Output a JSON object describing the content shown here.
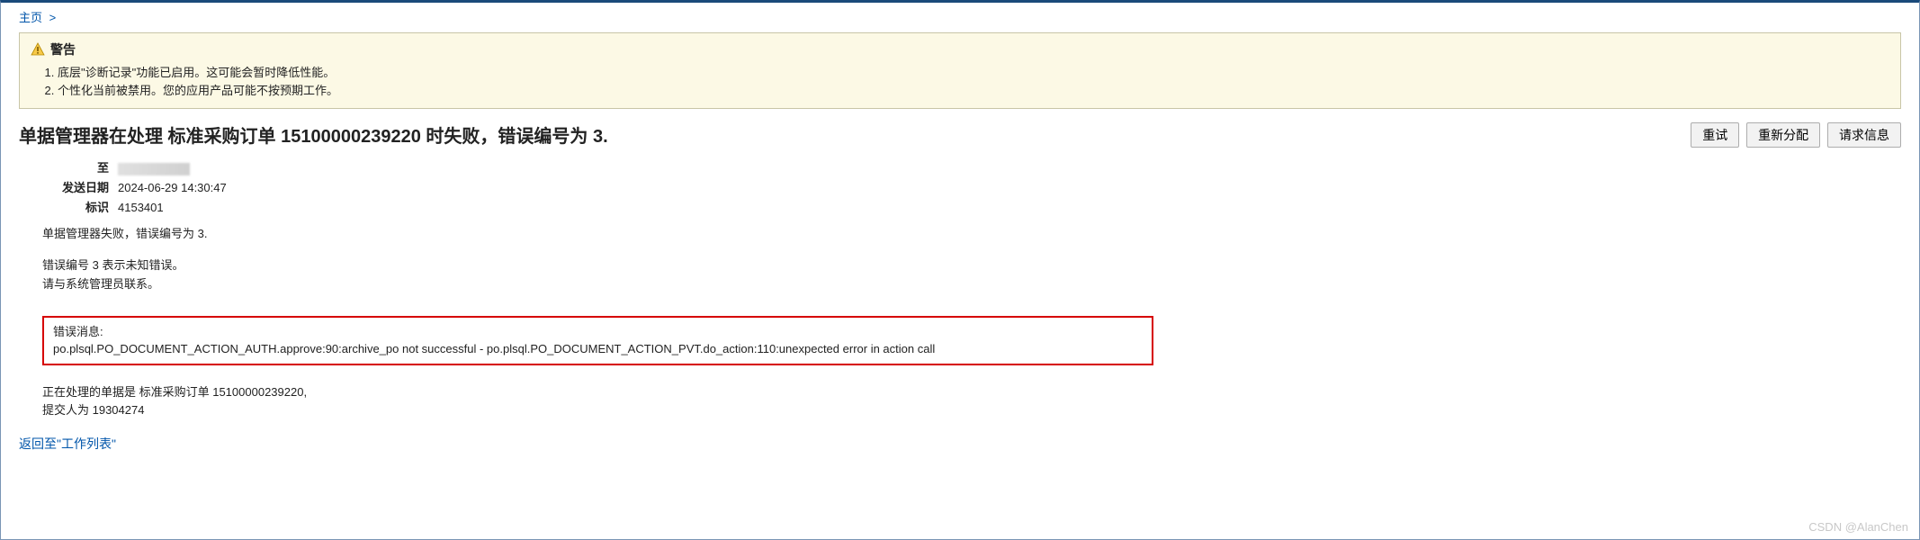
{
  "breadcrumb": {
    "home": "主页",
    "sep": ">"
  },
  "warning": {
    "title": "警告",
    "items": [
      "底层\"诊断记录\"功能已启用。这可能会暂时降低性能。",
      "个性化当前被禁用。您的应用产品可能不按预期工作。"
    ]
  },
  "header": {
    "title": "单据管理器在处理 标准采购订单 15100000239220 时失败，错误编号为 3.",
    "buttons": {
      "retry": "重试",
      "reassign": "重新分配",
      "request_info": "请求信息"
    }
  },
  "meta": {
    "to_label": "至",
    "to_value": "",
    "send_date_label": "发送日期",
    "send_date_value": "2024-06-29 14:30:47",
    "id_label": "标识",
    "id_value": "4153401"
  },
  "body": {
    "mgr_fail": "单据管理器失败，错误编号为 3.",
    "unknown_err": "错误编号 3 表示未知错误。",
    "contact_admin": "请与系统管理员联系。"
  },
  "error": {
    "label": "错误消息:",
    "message": "po.plsql.PO_DOCUMENT_ACTION_AUTH.approve:90:archive_po not successful - po.plsql.PO_DOCUMENT_ACTION_PVT.do_action:110:unexpected error in action call"
  },
  "processing": {
    "line1": "正在处理的单据是 标准采购订单 15100000239220,",
    "line2": "提交人为 19304274"
  },
  "back_link": "返回至\"工作列表\"",
  "watermark": "CSDN @AlanChen"
}
